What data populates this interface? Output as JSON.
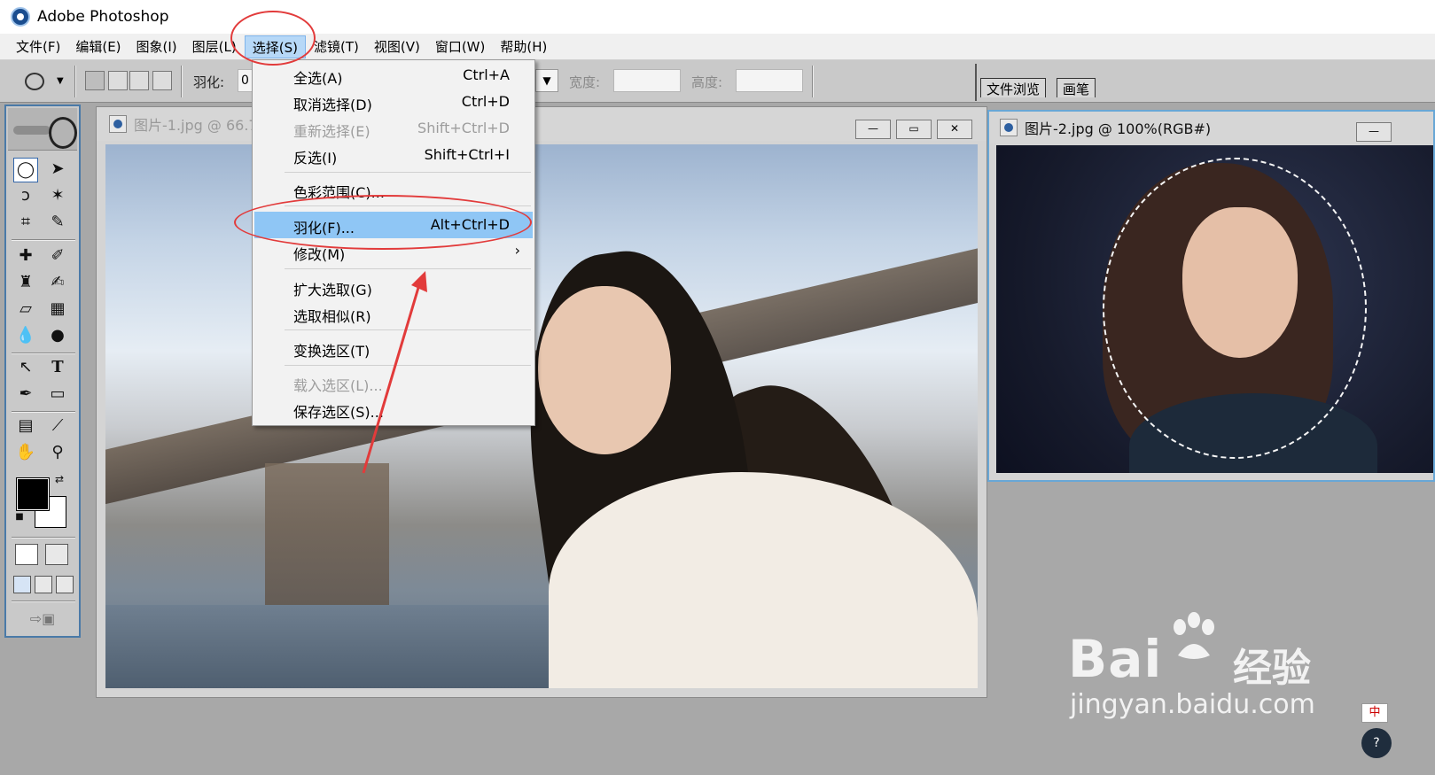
{
  "window": {
    "title": "Adobe Photoshop"
  },
  "menubar": {
    "items": [
      "文件(F)",
      "编辑(E)",
      "图象(I)",
      "图层(L)",
      "选择(S)",
      "滤镜(T)",
      "视图(V)",
      "窗口(W)",
      "帮助(H)"
    ],
    "active": "选择(S)"
  },
  "options_bar": {
    "feather_label": "羽化:",
    "feather_value": "0",
    "width_label": "宽度:",
    "height_label": "高度:",
    "palette_tabs": [
      "文件浏览",
      "画笔"
    ]
  },
  "select_menu": {
    "items": [
      {
        "label": "全选(A)",
        "shortcut": "Ctrl+A",
        "enabled": true
      },
      {
        "label": "取消选择(D)",
        "shortcut": "Ctrl+D",
        "enabled": true
      },
      {
        "label": "重新选择(E)",
        "shortcut": "Shift+Ctrl+D",
        "enabled": false
      },
      {
        "label": "反选(I)",
        "shortcut": "Shift+Ctrl+I",
        "enabled": true
      },
      {
        "label": "色彩范围(C)...",
        "shortcut": "",
        "enabled": true
      },
      {
        "label": "羽化(F)...",
        "shortcut": "Alt+Ctrl+D",
        "enabled": true,
        "highlighted": true
      },
      {
        "label": "修改(M)",
        "shortcut": "",
        "enabled": true,
        "submenu": true
      },
      {
        "label": "扩大选取(G)",
        "shortcut": "",
        "enabled": true
      },
      {
        "label": "选取相似(R)",
        "shortcut": "",
        "enabled": true
      },
      {
        "label": "变换选区(T)",
        "shortcut": "",
        "enabled": true
      },
      {
        "label": "载入选区(L)...",
        "shortcut": "",
        "enabled": false
      },
      {
        "label": "保存选区(S)...",
        "shortcut": "",
        "enabled": true
      }
    ]
  },
  "documents": [
    {
      "title": "图片-1.jpg @ 66.7",
      "active": false
    },
    {
      "title": "图片-2.jpg @ 100%(RGB#)",
      "active": true
    }
  ],
  "toolbox": {
    "foreground_color": "#000000",
    "background_color": "#ffffff"
  },
  "watermark": {
    "brand_left": "Bai",
    "brand_right": "经验",
    "url": "jingyan.baidu.com"
  },
  "corner_badge": "中",
  "colors": {
    "menu_highlight": "#8fc6f5",
    "annotation_red": "#e23b3b",
    "toolbox_border": "#4a7aa8"
  }
}
